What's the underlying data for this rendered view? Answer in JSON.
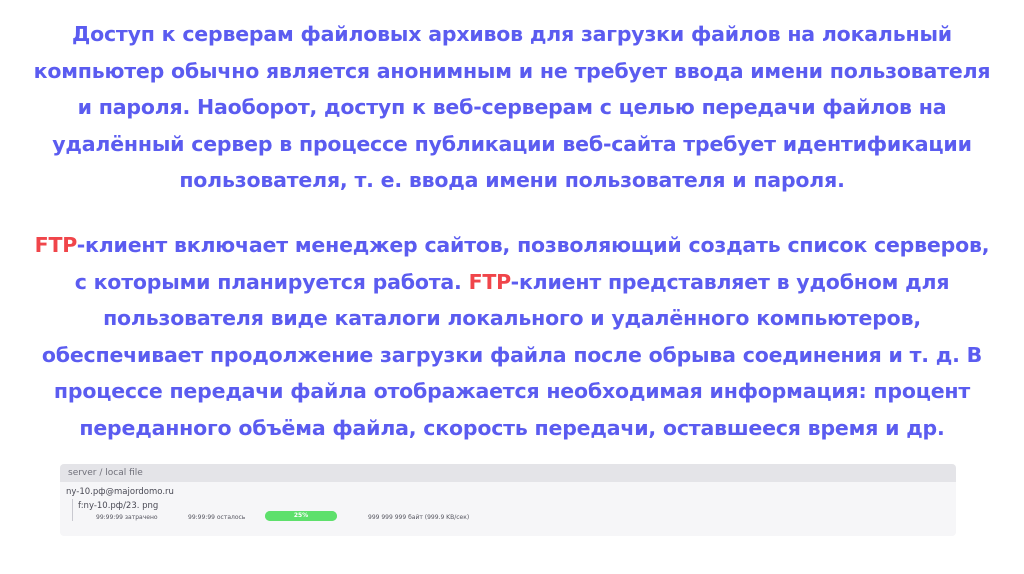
{
  "paragraph1": "Доступ к серверам файловых архивов для загрузки файлов на локальный компьютер обычно является анонимным и не требует ввода имени пользователя и пароля. Наоборот, доступ к веб-серверам с целью передачи файлов на удалённый сервер в процессе публикации веб-сайта требует идентификации пользователя, т. е. ввода имени пользователя и пароля.",
  "paragraph2": {
    "ftp1": "FTP",
    "text1": "-клиент включает менеджер сайтов, позволяющий создать список серверов, с которыми планируется работа. ",
    "ftp2": "FTP",
    "text2": "-клиент представляет в удобном для пользователя виде каталоги локального и удалённого компьютеров, обеспечивает продолжение загрузки файла после обрыва соединения и т. д. В процессе передачи файла отображается необходимая информация: процент переданного объёма файла, скорость передачи, оставшееся время и др."
  },
  "transfer_panel": {
    "title": "server / local file",
    "server": "ny-10.рф@majordomo.ru",
    "file": "f:ny-10.рф/23. png",
    "time_spent": "99:99:99 затрачено",
    "time_left": "99:99:99 осталось",
    "progress_label": "25%",
    "progress_fraction": 1.0,
    "bytes": "999 999 999 байт (999.9 KB/сек)"
  },
  "colors": {
    "text": "#5b5cf0",
    "ftp_accent": "#f0454a",
    "progress": "#5ee06c"
  }
}
